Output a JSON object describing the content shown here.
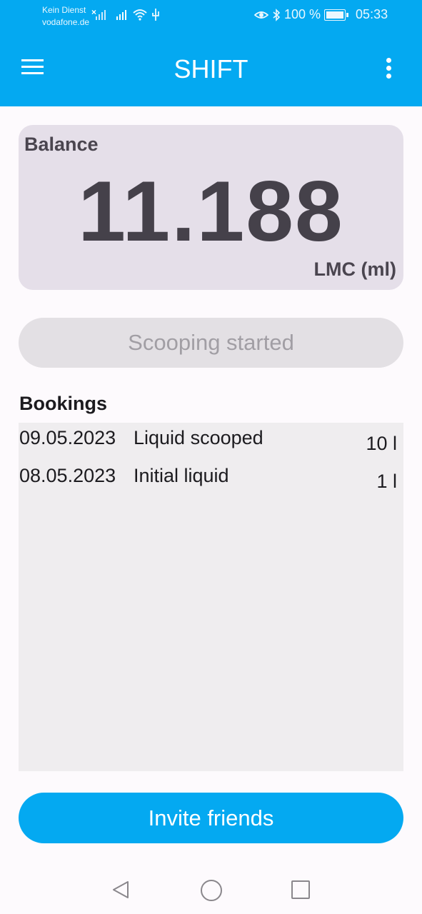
{
  "status_bar": {
    "carrier_line1": "Kein Dienst",
    "carrier_line2": "vodafone.de",
    "no_sim_mark": "×",
    "battery": "100 %",
    "time": "05:33",
    "icons": [
      "signal-icon",
      "signal-icon",
      "wifi-icon",
      "usb-icon",
      "eye-icon",
      "bluetooth-icon",
      "battery-icon"
    ]
  },
  "app_bar": {
    "title": "SHIFT",
    "menu_icon": "hamburger-menu-icon",
    "more_icon": "more-vertical-icon"
  },
  "balance": {
    "label": "Balance",
    "value": "11.188",
    "unit": "LMC (ml)"
  },
  "scoop_button": {
    "label": "Scooping started"
  },
  "bookings": {
    "title": "Bookings",
    "items": [
      {
        "date": "09.05.2023",
        "description": "Liquid scooped",
        "amount": "10 l"
      },
      {
        "date": "08.05.2023",
        "description": "Initial liquid",
        "amount": "1 l"
      }
    ]
  },
  "invite_button": {
    "label": "Invite friends"
  },
  "nav_bar": {
    "icons": [
      "back-icon",
      "home-icon",
      "recent-apps-icon"
    ]
  },
  "colors": {
    "primary": "#04a9f1",
    "card": "#e5dfe9",
    "list_bg": "#efedef",
    "disabled_button": "#e3e0e4"
  }
}
